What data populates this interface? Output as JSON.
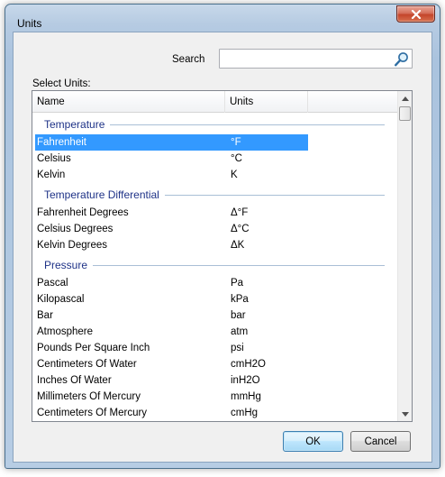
{
  "window": {
    "title": "Units"
  },
  "search": {
    "label": "Search",
    "value": ""
  },
  "select_label": "Select Units:",
  "columns": {
    "name": "Name",
    "units": "Units"
  },
  "groups": [
    {
      "title": "Temperature",
      "items": [
        {
          "name": "Fahrenheit",
          "unit": "°F",
          "selected": true
        },
        {
          "name": "Celsius",
          "unit": "°C"
        },
        {
          "name": "Kelvin",
          "unit": "K"
        }
      ]
    },
    {
      "title": "Temperature Differential",
      "items": [
        {
          "name": "Fahrenheit Degrees",
          "unit": "Δ°F"
        },
        {
          "name": "Celsius Degrees",
          "unit": "Δ°C"
        },
        {
          "name": "Kelvin Degrees",
          "unit": "ΔK"
        }
      ]
    },
    {
      "title": "Pressure",
      "items": [
        {
          "name": "Pascal",
          "unit": "Pa"
        },
        {
          "name": "Kilopascal",
          "unit": "kPa"
        },
        {
          "name": "Bar",
          "unit": "bar"
        },
        {
          "name": "Atmosphere",
          "unit": "atm"
        },
        {
          "name": "Pounds Per Square Inch",
          "unit": "psi"
        },
        {
          "name": "Centimeters Of Water",
          "unit": "cmH2O"
        },
        {
          "name": "Inches Of Water",
          "unit": "inH2O"
        },
        {
          "name": "Millimeters Of Mercury",
          "unit": "mmHg"
        },
        {
          "name": "Centimeters Of Mercury",
          "unit": "cmHg"
        }
      ]
    }
  ],
  "buttons": {
    "ok": "OK",
    "cancel": "Cancel"
  },
  "icons": {
    "close": "close-icon",
    "search": "search-icon",
    "scroll_up": "chevron-up-icon",
    "scroll_down": "chevron-down-icon"
  },
  "colors": {
    "selection": "#3399ff",
    "group_title": "#1e3287",
    "close_button": "#c4452b"
  }
}
